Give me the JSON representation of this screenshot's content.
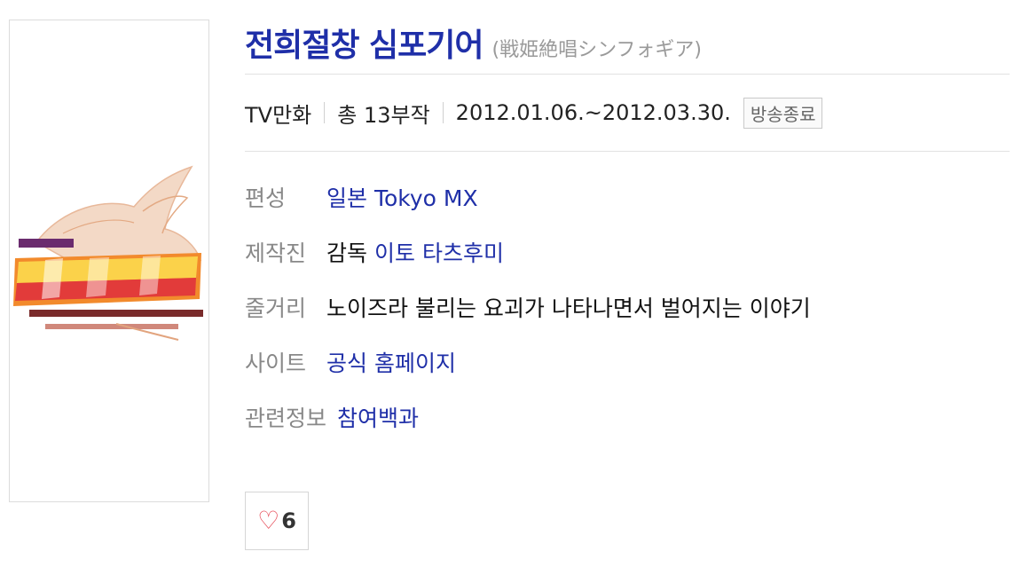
{
  "poster": {
    "logo_icon": "symphogear-logo"
  },
  "title": {
    "korean": "전희절창 심포기어",
    "original": "(戦姫絶唱シンフォギア)"
  },
  "meta": {
    "type": "TV만화",
    "episodes": "총 13부작",
    "dates": "2012.01.06.~2012.03.30.",
    "status": "방송종료"
  },
  "details": {
    "broadcast_label": "편성",
    "broadcast_value": "일본 Tokyo MX",
    "staff_label": "제작진",
    "staff_role": "감독",
    "staff_name": "이토 타츠후미",
    "plot_label": "줄거리",
    "plot_value": "노이즈라 불리는 요괴가 나타나면서 벌어지는 이야기",
    "site_label": "사이트",
    "site_value": "공식 홈페이지",
    "related_label": "관련정보",
    "related_value": "참여백과"
  },
  "like": {
    "icon": "heart-icon",
    "count": "6"
  }
}
